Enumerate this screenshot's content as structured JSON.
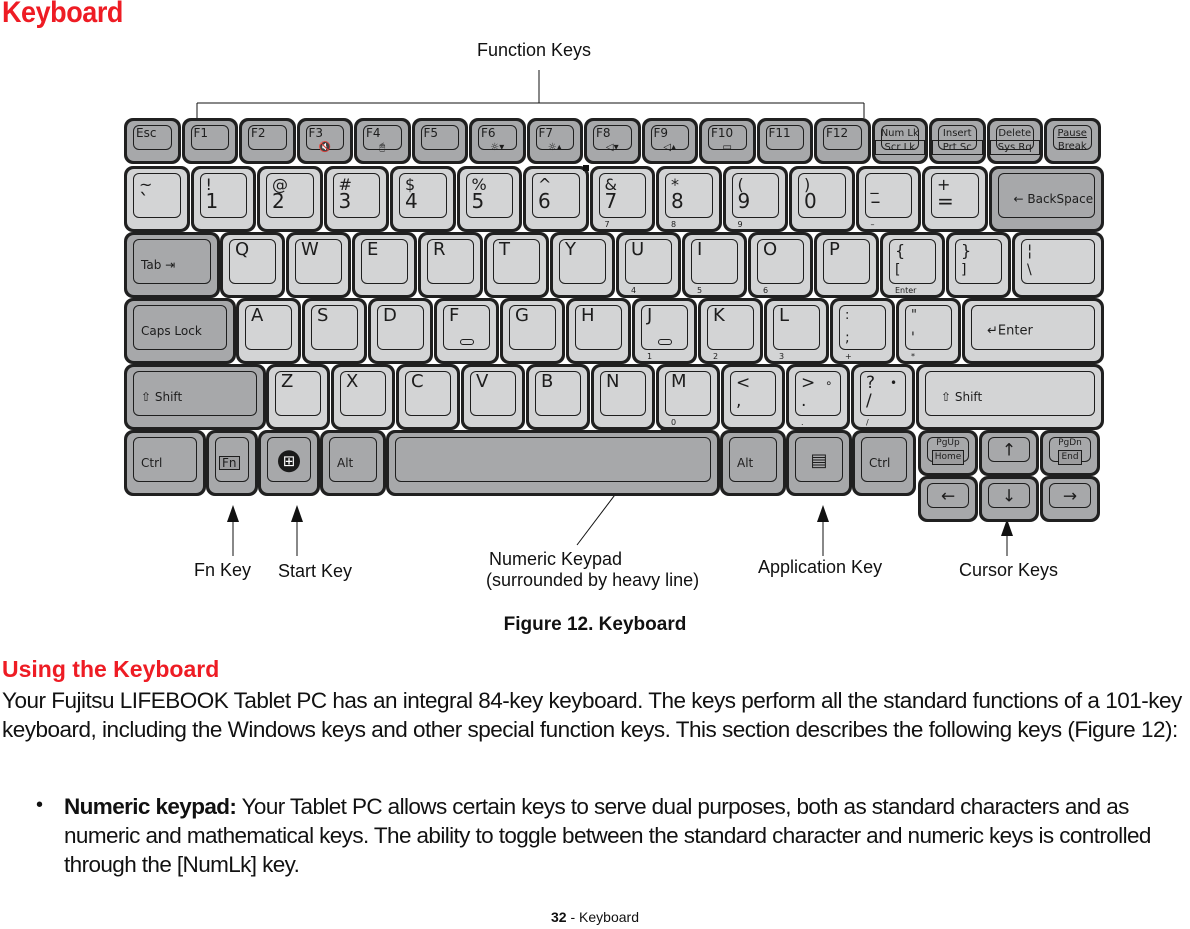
{
  "page": {
    "title": "Keyboard",
    "figure_caption": "Figure 12.  Keyboard",
    "section_heading": "Using the Keyboard",
    "intro_paragraph": "Your Fujitsu LIFEBOOK Tablet PC has an integral 84-key keyboard. The keys perform all the standard functions of a 101-key keyboard, including the Windows keys and other special function keys. This section describes the following keys (Figure 12):",
    "bullets": [
      {
        "term": "Numeric keypad:",
        "text": " Your Tablet PC allows certain keys to serve dual purposes, both as standard characters and as numeric and mathematical keys. The ability to toggle between the standard character and numeric keys is controlled through the [NumLk] key."
      }
    ],
    "footer": {
      "page_number": "32",
      "separator": " - ",
      "section": "Keyboard"
    },
    "accent_color": "#ee1c24"
  },
  "callouts": {
    "function_keys": "Function Keys",
    "fn_key": "Fn Key",
    "start_key": "Start Key",
    "numeric_keypad_line1": "Numeric Keypad",
    "numeric_keypad_line2": "(surrounded by heavy line)",
    "application_key": "Application Key",
    "cursor_keys": "Cursor Keys"
  },
  "keyboard": {
    "key_colors": {
      "light": "#d3d4d5",
      "dark": "#a7a8aa",
      "outline": "#202020"
    },
    "row_function": [
      {
        "main": "Esc",
        "sub": ""
      },
      {
        "main": "F1",
        "sub": ""
      },
      {
        "main": "F2",
        "sub": ""
      },
      {
        "main": "F3",
        "sub": "🔇",
        "sub_icon": "mute-icon"
      },
      {
        "main": "F4",
        "sub": "🖱",
        "sub_icon": "touchpad-toggle-icon"
      },
      {
        "main": "F5",
        "sub": ""
      },
      {
        "main": "F6",
        "sub": "☼▾",
        "sub_icon": "brightness-down-icon"
      },
      {
        "main": "F7",
        "sub": "☼▴",
        "sub_icon": "brightness-up-icon"
      },
      {
        "main": "F8",
        "sub": "◁▾",
        "sub_icon": "volume-down-icon"
      },
      {
        "main": "F9",
        "sub": "◁▴",
        "sub_icon": "volume-up-icon"
      },
      {
        "main": "F10",
        "sub": "▭",
        "sub_icon": "display-toggle-icon"
      },
      {
        "main": "F11",
        "sub": ""
      },
      {
        "main": "F12",
        "sub": ""
      },
      {
        "main": "Num Lk",
        "sub": "Scr Lk"
      },
      {
        "main": "Insert",
        "sub": "Prt Sc"
      },
      {
        "main": "Delete",
        "sub": "Sys Rq"
      },
      {
        "main": "Pause",
        "sub": "Break"
      }
    ],
    "row_number": [
      {
        "top": "~",
        "bot": "`",
        "keypad": ""
      },
      {
        "top": "!",
        "bot": "1",
        "keypad": ""
      },
      {
        "top": "@",
        "bot": "2",
        "keypad": ""
      },
      {
        "top": "#",
        "bot": "3",
        "keypad": ""
      },
      {
        "top": "$",
        "bot": "4",
        "keypad": ""
      },
      {
        "top": "%",
        "bot": "5",
        "keypad": ""
      },
      {
        "top": "^",
        "bot": "6",
        "keypad": ""
      },
      {
        "top": "&",
        "bot": "7",
        "keypad": "7"
      },
      {
        "top": "*",
        "bot": "8",
        "keypad": "8"
      },
      {
        "top": "(",
        "bot": "9",
        "keypad": "9"
      },
      {
        "top": ")",
        "bot": "0",
        "keypad": ""
      },
      {
        "top": "_",
        "bot": "–",
        "keypad": "–"
      },
      {
        "top": "+",
        "bot": "=",
        "keypad": ""
      }
    ],
    "backspace": "← BackSpace",
    "tab": "Tab ⇥",
    "row_qwerty": [
      {
        "main": "Q",
        "keypad": ""
      },
      {
        "main": "W",
        "keypad": ""
      },
      {
        "main": "E",
        "keypad": ""
      },
      {
        "main": "R",
        "keypad": ""
      },
      {
        "main": "T",
        "keypad": ""
      },
      {
        "main": "Y",
        "keypad": ""
      },
      {
        "main": "U",
        "keypad": "4"
      },
      {
        "main": "I",
        "keypad": "5"
      },
      {
        "main": "O",
        "keypad": "6"
      },
      {
        "main": "P",
        "keypad": ""
      }
    ],
    "row_qwerty_symbols": [
      {
        "top": "{",
        "bot": "[",
        "keypad": "Enter"
      },
      {
        "top": "}",
        "bot": "]",
        "keypad": ""
      },
      {
        "top": "¦",
        "bot": "\\",
        "keypad": ""
      }
    ],
    "caps_lock": "Caps Lock",
    "row_home": [
      {
        "main": "A",
        "keypad": ""
      },
      {
        "main": "S",
        "keypad": ""
      },
      {
        "main": "D",
        "keypad": ""
      },
      {
        "main": "F",
        "keypad": "",
        "bump": true
      },
      {
        "main": "G",
        "keypad": ""
      },
      {
        "main": "H",
        "keypad": ""
      },
      {
        "main": "J",
        "keypad": "1",
        "bump": true
      },
      {
        "main": "K",
        "keypad": "2"
      },
      {
        "main": "L",
        "keypad": "3"
      }
    ],
    "row_home_symbols": [
      {
        "top": ":",
        "bot": ";",
        "keypad": "+"
      },
      {
        "top": "\"",
        "bot": "'",
        "keypad": "*"
      }
    ],
    "enter": "↵Enter",
    "shift_left": "⇧ Shift",
    "row_bottom_letters": [
      {
        "main": "Z",
        "keypad": ""
      },
      {
        "main": "X",
        "keypad": ""
      },
      {
        "main": "C",
        "keypad": ""
      },
      {
        "main": "V",
        "keypad": ""
      },
      {
        "main": "B",
        "keypad": ""
      },
      {
        "main": "N",
        "keypad": ""
      },
      {
        "main": "M",
        "keypad": "0"
      }
    ],
    "row_bottom_symbols": [
      {
        "top": "<",
        "bot": ",",
        "extra": "",
        "keypad": ""
      },
      {
        "top": ">",
        "bot": ".",
        "extra": "∘",
        "keypad": "."
      },
      {
        "top": "?",
        "bot": "/",
        "extra": "•",
        "keypad": "/"
      }
    ],
    "shift_right": "⇧ Shift",
    "row_space": {
      "ctrl_left": "Ctrl",
      "fn": "Fn",
      "alt_left": "Alt",
      "alt_right": "Alt",
      "ctrl_right": "Ctrl"
    },
    "nav": {
      "pgup": "PgUp",
      "home": "Home",
      "up": "↑",
      "pgdn": "PgDn",
      "end": "End",
      "left": "←",
      "down": "↓",
      "right": "→"
    }
  }
}
